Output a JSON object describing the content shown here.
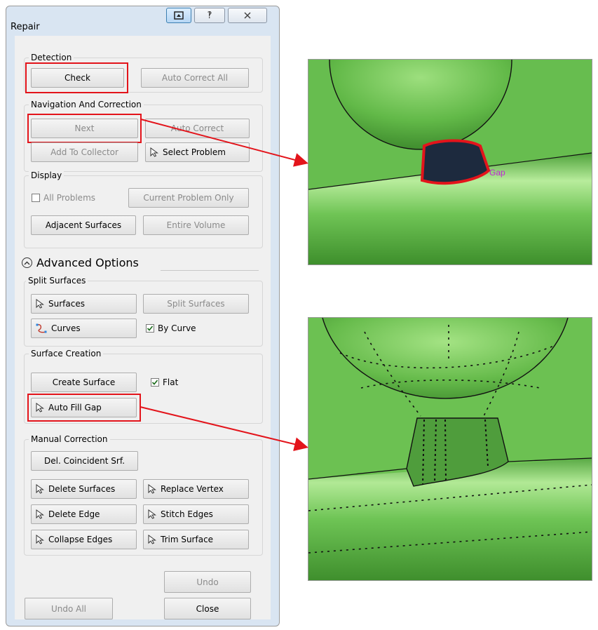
{
  "dialog": {
    "title": "Repair",
    "title_buttons": [
      "restore-icon",
      "help-icon",
      "close-icon"
    ]
  },
  "detection": {
    "legend": "Detection",
    "check": "Check",
    "auto_correct_all": "Auto Correct All"
  },
  "navigation": {
    "legend": "Navigation And Correction",
    "next": "Next",
    "auto_correct": "Auto Correct",
    "add_to_collector": "Add To Collector",
    "select_problem": "Select Problem"
  },
  "display": {
    "legend": "Display",
    "all_problems": "All Problems",
    "all_problems_checked": false,
    "current_problem_only": "Current Problem Only",
    "adjacent_surfaces": "Adjacent Surfaces",
    "entire_volume": "Entire Volume"
  },
  "advanced": {
    "label": "Advanced Options"
  },
  "split": {
    "legend": "Split Surfaces",
    "surfaces": "Surfaces",
    "split_surfaces": "Split Surfaces",
    "curves": "Curves",
    "by_curve": "By Curve",
    "by_curve_checked": true
  },
  "surface_creation": {
    "legend": "Surface Creation",
    "create_surface": "Create Surface",
    "flat": "Flat",
    "flat_checked": true,
    "auto_fill_gap": "Auto Fill Gap"
  },
  "manual": {
    "legend": "Manual Correction",
    "del_coincident": "Del. Coincident Srf.",
    "delete_surfaces": "Delete Surfaces",
    "replace_vertex": "Replace Vertex",
    "delete_edge": "Delete Edge",
    "stitch_edges": "Stitch Edges",
    "collapse_edges": "Collapse Edges",
    "trim_surface": "Trim Surface"
  },
  "footer": {
    "undo": "Undo",
    "undo_all": "Undo All",
    "close": "Close"
  },
  "viewport_top": {
    "gap_label": "Gap"
  },
  "colors": {
    "highlight": "#e3141b",
    "surface_green": "#5fb54a",
    "gap_fill": "#1d2a3e",
    "gap_label": "#c026d3"
  }
}
